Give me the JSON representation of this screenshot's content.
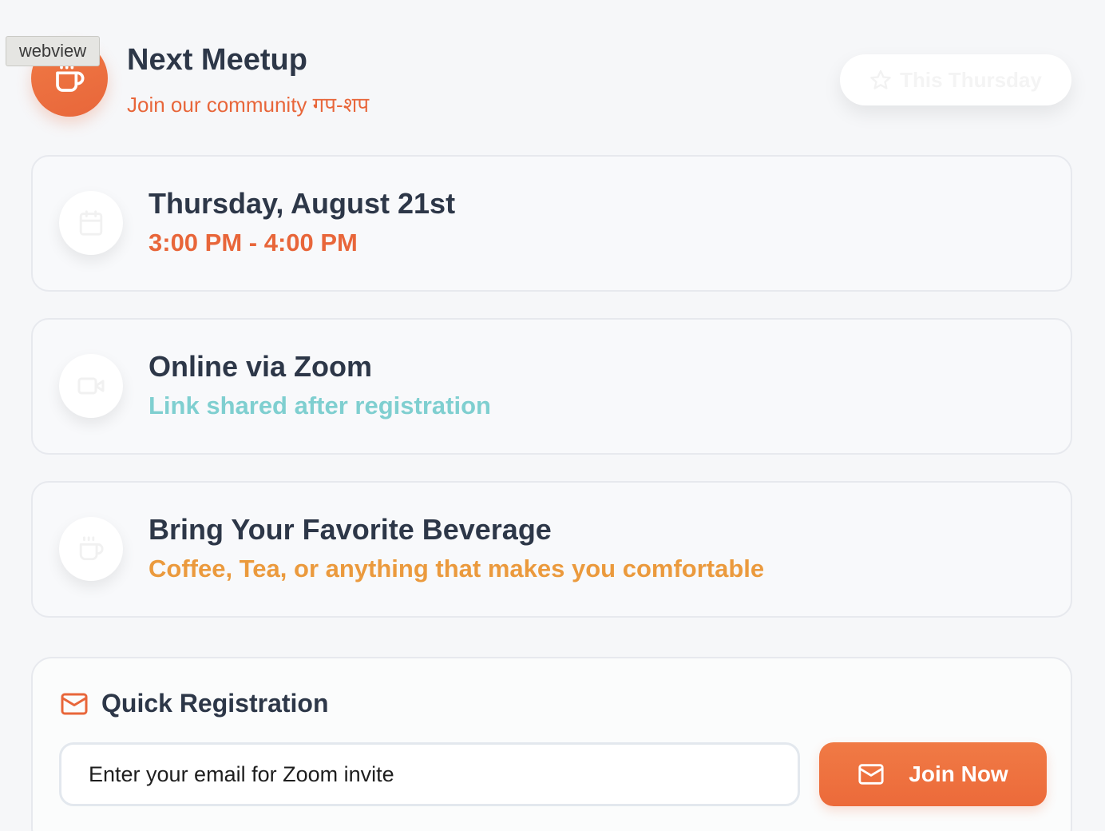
{
  "window": {
    "tag": "webview"
  },
  "header": {
    "title": "Next Meetup",
    "subtitle": "Join our community गप-शप",
    "badge": "This Thursday"
  },
  "details": [
    {
      "icon": "calendar-icon",
      "title": "Thursday, August 21st",
      "subtitle": "3:00 PM - 4:00 PM",
      "color": "#e8663a"
    },
    {
      "icon": "video-camera-icon",
      "title": "Online via Zoom",
      "subtitle": "Link shared after registration",
      "color": "#7fcfd0"
    },
    {
      "icon": "coffee-cup-icon",
      "title": "Bring Your Favorite Beverage",
      "subtitle": "Coffee, Tea, or anything that makes you comfortable",
      "color": "#eb9a3d"
    }
  ],
  "registration": {
    "title": "Quick Registration",
    "email_placeholder": "Enter your email for Zoom invite",
    "email_value": "",
    "button_label": "Join Now"
  },
  "colors": {
    "accent": "#e8663a",
    "text": "#2d3748",
    "teal": "#7fcfd0",
    "amber": "#eb9a3d"
  }
}
